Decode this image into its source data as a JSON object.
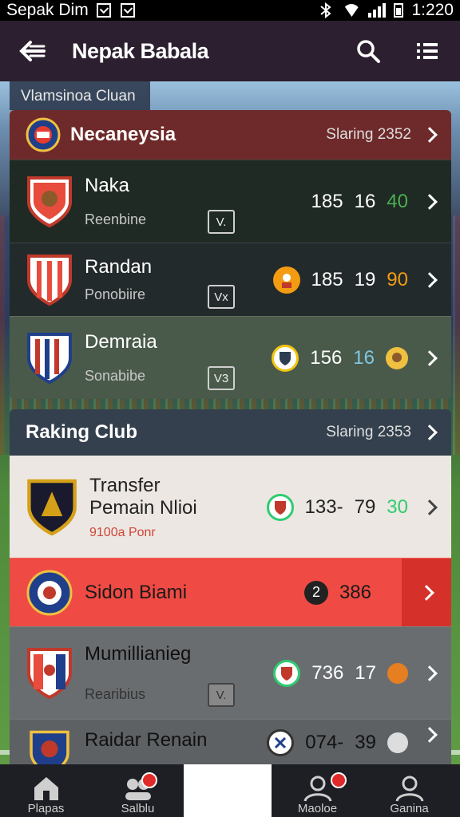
{
  "status_bar": {
    "left_text": "Sepak Dim",
    "time": "1:220"
  },
  "app_bar": {
    "title": "Nepak Babala"
  },
  "section_tag": "Vlamsinoa Cluan",
  "group1": {
    "name": "Necaneysia",
    "rank": "Slaring 2352",
    "rows": [
      {
        "club": "Naka",
        "sub": "Reenbine",
        "box": "V.",
        "s1": "185",
        "s2": "16",
        "s3": "40",
        "s3_color": "#4caf50"
      },
      {
        "club": "Randan",
        "sub": "Ponobiire",
        "box": "Vx",
        "s1": "185",
        "s2": "19",
        "s3": "90",
        "s3_color": "#f39c12"
      },
      {
        "club": "Demraia",
        "sub": "Sonabibe",
        "box": "V3",
        "s1": "156",
        "s2": "16",
        "s3": "",
        "s2_color": "#7ec8e3"
      }
    ]
  },
  "group2": {
    "name": "Raking Club",
    "rank": "Slaring 2353",
    "rows": [
      {
        "club": "Transfer Pemain Nlioi",
        "sub": "9100a Ponr",
        "s1": "133-",
        "s2": "79",
        "s3": "30",
        "s3_color": "#2ecc71"
      },
      {
        "club": "Sidon Biami",
        "badge": "2",
        "s1": "386"
      },
      {
        "club": "Mumillianieg",
        "sub": "Rearibius",
        "box": "V.",
        "s1": "736",
        "s2": "17"
      },
      {
        "club": "Raidar Renain",
        "s1": "074-",
        "s2": "39"
      }
    ]
  },
  "bottom_nav": [
    {
      "label": "Plapas",
      "icon": "home-icon"
    },
    {
      "label": "Salblu",
      "icon": "team-icon"
    },
    {
      "label": "",
      "icon": ""
    },
    {
      "label": "Maoloe",
      "icon": "profile-icon"
    },
    {
      "label": "Ganina",
      "icon": "user-icon"
    }
  ]
}
